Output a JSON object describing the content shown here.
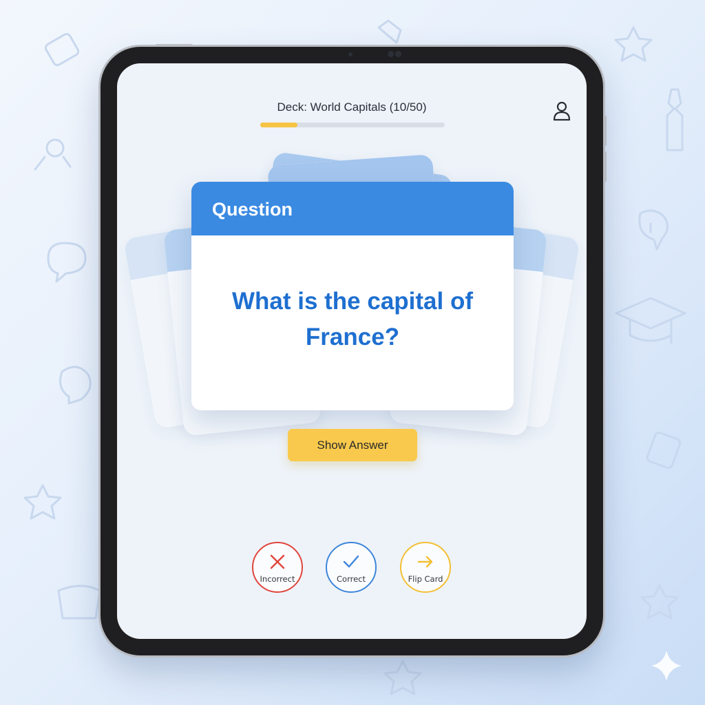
{
  "deck": {
    "title": "Deck: World Capitals (10/50)",
    "progress": 0.2
  },
  "card": {
    "header": "Question",
    "question": "What is the capital of France?"
  },
  "actions": {
    "show_answer": "Show Answer",
    "incorrect": "Incorrect",
    "correct": "Correct",
    "flip": "Flip Card"
  },
  "colors": {
    "accent_blue": "#3a8ae2",
    "question_text": "#1e6fd0",
    "accent_yellow": "#f8c94c",
    "incorrect_red": "#e0453d",
    "correct_blue": "#3d85da",
    "flip_yellow": "#f3bf33"
  },
  "icons": {
    "profile": "user-icon",
    "incorrect": "close-icon",
    "correct": "check-icon",
    "flip": "arrow-right-icon"
  }
}
